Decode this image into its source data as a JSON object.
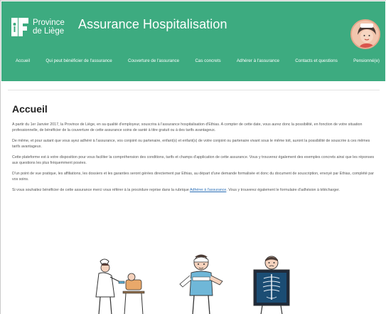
{
  "header": {
    "logo_line1": "Province",
    "logo_line2": "de Liège",
    "site_title": "Assurance Hospitalisation"
  },
  "nav": {
    "items": [
      "Accueil",
      "Qui peut bénéficier de l'assurance",
      "Couverture de l'assurance",
      "Cas concrets",
      "Adhérer à l'assurance",
      "Contacts et questions",
      "Pensionné(e)"
    ]
  },
  "main": {
    "title": "Accueil",
    "paragraphs": [
      "A partir du 1er Janvier 2017, la Province de Liège, en sa qualité d'employeur, souscrira à l'assurance hospitalisation d'Ethias. A compter de cette date, vous aurez donc la possibilité, en fonction de votre situation professionnelle, de bénéficier de la couverture de cette assurance soins de santé à titre gratuit ou à des tarifs avantageux.",
      "De même, et pour autant que vous ayez adhéré à l'assurance, vos conjoint ou partenaire, enfant(s) et enfant(s) de votre conjoint ou partenaire vivant sous le même toit, auront la possibilité de souscrire à ces mêmes tarifs avantageux.",
      "Cette plateforme est à votre disposition pour vous faciliter la compréhension des conditions, tarifs et champs d'application de cette assurance. Vous y trouverez également des exemples concrets ainsi que les réponses aux questions les plus fréquemment posées.",
      "D'un point de vue pratique, les affiliations, les dossiers et les garanties seront gérées directement par Ethias, au départ d'une demande formalisée et donc du document de souscription, envoyé par Ethias, complété par vos soins."
    ],
    "last_paragraph_before": "Si vous souhaitez bénéficier de cette assurance merci vous référer à la procédure reprise dans la rubrique ",
    "last_paragraph_link": "Adhérer à l'assurance",
    "last_paragraph_after": ". Vous y trouverez également le formulaire d'adhésion à télécharger."
  },
  "colors": {
    "header_green": "#3dab80",
    "link_blue": "#2b6fb6",
    "text": "#555555"
  },
  "icons": {
    "logo": "province-liege-logo-icon",
    "avatar": "nurse-avatar-icon"
  }
}
